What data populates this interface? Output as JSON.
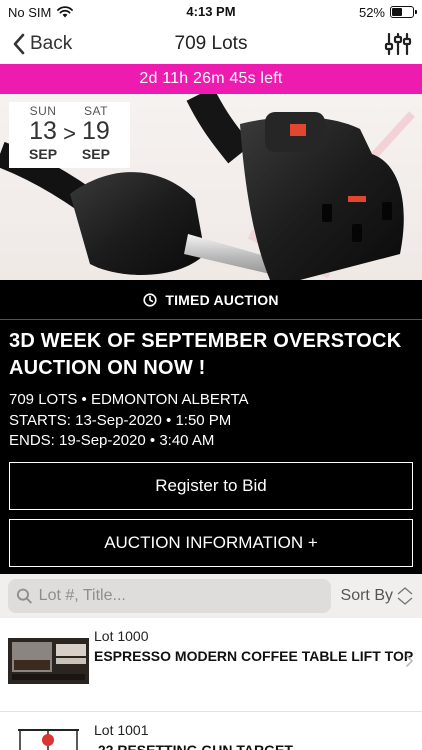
{
  "status_bar": {
    "carrier": "No SIM",
    "time": "4:13 PM",
    "battery": "52%",
    "battery_level": 0.52
  },
  "nav": {
    "back_label": "Back",
    "title": "709 Lots"
  },
  "countdown": {
    "text": "2d 11h 26m 45s left",
    "color": "#ee1bb1"
  },
  "dates": {
    "start": {
      "day": "SUN",
      "num": "13",
      "month": "SEP"
    },
    "separator": ">",
    "end": {
      "day": "SAT",
      "num": "19",
      "month": "SEP"
    }
  },
  "auction": {
    "type_label": "TIMED AUCTION",
    "title": "3D WEEK OF SEPTEMBER OVERSTOCK AUCTION ON NOW !",
    "lots_location": "709 LOTS • EDMONTON ALBERTA",
    "starts": "STARTS: 13-Sep-2020 • 1:50 PM",
    "ends": "ENDS: 19-Sep-2020 • 3:40 AM",
    "register_label": "Register to Bid",
    "info_label": "AUCTION INFORMATION +"
  },
  "search": {
    "placeholder": "Lot #, Title...",
    "value": "",
    "sort_label": "Sort By"
  },
  "lots": [
    {
      "number": "Lot 1000",
      "title": "ESPRESSO MODERN COFFEE TABLE LIFT TOP"
    },
    {
      "number": "Lot 1001",
      "title": ".22 RESETTING GUN TARGET"
    }
  ]
}
